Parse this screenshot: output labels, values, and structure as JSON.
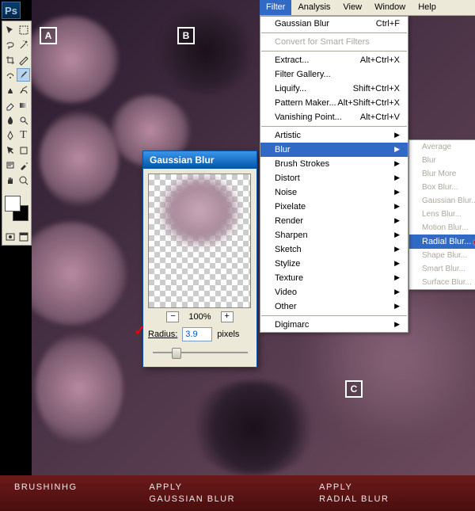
{
  "ps_badge": "Ps",
  "markers": {
    "a": "A",
    "b": "B",
    "c": "C"
  },
  "menubar": [
    "Filter",
    "Analysis",
    "View",
    "Window",
    "Help"
  ],
  "filter_menu": {
    "top": [
      {
        "label": "Gaussian Blur",
        "shortcut": "Ctrl+F"
      }
    ],
    "smart": "Convert for Smart Filters",
    "edit": [
      {
        "label": "Extract...",
        "shortcut": "Alt+Ctrl+X"
      },
      {
        "label": "Filter Gallery...",
        "shortcut": ""
      },
      {
        "label": "Liquify...",
        "shortcut": "Shift+Ctrl+X"
      },
      {
        "label": "Pattern Maker...",
        "shortcut": "Alt+Shift+Ctrl+X"
      },
      {
        "label": "Vanishing Point...",
        "shortcut": "Alt+Ctrl+V"
      }
    ],
    "cats": [
      "Artistic",
      "Blur",
      "Brush Strokes",
      "Distort",
      "Noise",
      "Pixelate",
      "Render",
      "Sharpen",
      "Sketch",
      "Stylize",
      "Texture",
      "Video",
      "Other"
    ],
    "last": "Digimarc"
  },
  "blur_submenu": [
    "Average",
    "Blur",
    "Blur More",
    "Box Blur...",
    "Gaussian Blur...",
    "Lens Blur...",
    "Motion Blur...",
    "Radial Blur...",
    "Shape Blur...",
    "Smart Blur...",
    "Surface Blur..."
  ],
  "dialog": {
    "title": "Gaussian Blur",
    "zoom": "100%",
    "radius_label": "Radius:",
    "radius_value": "3.9",
    "radius_unit": "pixels",
    "minus": "−",
    "plus": "+"
  },
  "captions": {
    "a": "BRUSHINHG",
    "b1": "APPLY",
    "b2": "GAUSSIAN BLUR",
    "c1": "APPLY",
    "c2": "RADIAL BLUR"
  }
}
